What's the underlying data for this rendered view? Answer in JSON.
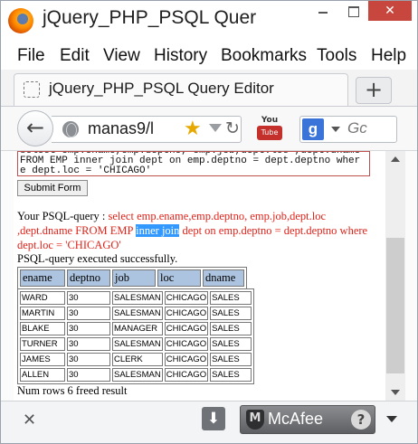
{
  "window": {
    "title": "jQuery_PHP_PSQL Quer",
    "close_glyph": "✕"
  },
  "menu": {
    "items": [
      "File",
      "Edit",
      "View",
      "History",
      "Bookmarks",
      "Tools",
      "Help"
    ]
  },
  "tab": {
    "title": "jQuery_PHP_PSQL Query Editor",
    "new_tab_glyph": "+"
  },
  "nav": {
    "back_glyph": "←",
    "url": "manas9/l",
    "star_glyph": "★",
    "reload_glyph": "↻",
    "youtube_top": "You",
    "youtube_bottom": "Tube",
    "search_engine_letter": "g",
    "search_placeholder": "Gc"
  },
  "page": {
    "query_text": "select emp.ename,emp.deptno, emp.job,dept.loc ,dept.dname FROM EMP inner join dept on emp.deptno = dept.deptno where dept.loc = 'CHICAGO'",
    "submit_label": "Submit Form",
    "result_prefix": "Your PSQL-query : ",
    "result_query_part1": "select emp.ename,emp.deptno, emp.job,dept.loc ,dept.dname FROM EMP ",
    "result_query_highlight": "inner join",
    "result_query_part2": " dept on emp.deptno = dept.deptno where dept.loc = 'CHICAGO'",
    "status": "PSQL-query executed successfully.",
    "headers": [
      "ename",
      "deptno",
      "job",
      "loc",
      "dname"
    ],
    "rows": [
      [
        "WARD",
        "30",
        "SALESMAN",
        "CHICAGO",
        "SALES"
      ],
      [
        "MARTIN",
        "30",
        "SALESMAN",
        "CHICAGO",
        "SALES"
      ],
      [
        "BLAKE",
        "30",
        "MANAGER",
        "CHICAGO",
        "SALES"
      ],
      [
        "TURNER",
        "30",
        "SALESMAN",
        "CHICAGO",
        "SALES"
      ],
      [
        "JAMES",
        "30",
        "CLERK",
        "CHICAGO",
        "SALES"
      ],
      [
        "ALLEN",
        "30",
        "SALESMAN",
        "CHICAGO",
        "SALES"
      ]
    ],
    "footer": "Num rows 6 freed result"
  },
  "addon_bar": {
    "close_glyph": "✕",
    "download_glyph": "⬇",
    "mcafee_label": "McAfee",
    "mcafee_help": "?"
  },
  "colors": {
    "query_red": "#e2231a",
    "header_cell": "#adc4e0",
    "selection": "#3399ff",
    "close_button": "#c7463d"
  }
}
